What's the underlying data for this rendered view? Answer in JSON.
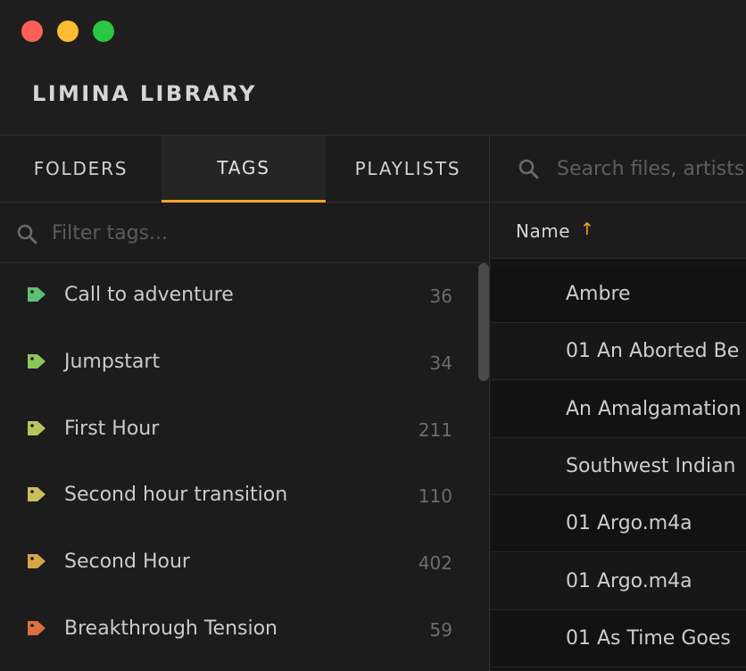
{
  "app": {
    "title": "LIMINA LIBRARY"
  },
  "tabs": [
    {
      "label": "FOLDERS"
    },
    {
      "label": "TAGS"
    },
    {
      "label": "PLAYLISTS"
    }
  ],
  "active_tab": "TAGS",
  "tag_filter": {
    "placeholder": "Filter tags..."
  },
  "tags": [
    {
      "name": "Call to adventure",
      "count": "36",
      "color": "#5fbf74"
    },
    {
      "name": "Jumpstart",
      "count": "34",
      "color": "#8cc65a"
    },
    {
      "name": "First Hour",
      "count": "211",
      "color": "#b9c461"
    },
    {
      "name": "Second hour transition",
      "count": "110",
      "color": "#c9bf5c"
    },
    {
      "name": "Second Hour",
      "count": "402",
      "color": "#d6a54a"
    },
    {
      "name": "Breakthrough Tension",
      "count": "59",
      "color": "#d9703e"
    }
  ],
  "search": {
    "placeholder": "Search files, artists..."
  },
  "file_table": {
    "column_name": "Name",
    "sort_indicator": "↑",
    "rows": [
      {
        "name": "Ambre"
      },
      {
        "name": "01 An Aborted Be"
      },
      {
        "name": "An Amalgamation"
      },
      {
        "name": "Southwest Indian"
      },
      {
        "name": "01 Argo.m4a"
      },
      {
        "name": "01 Argo.m4a"
      },
      {
        "name": "01 As Time Goes"
      }
    ]
  },
  "colors": {
    "accent": "#f5a623",
    "background": "#1b1b1c",
    "traffic_close": "#fe5f57",
    "traffic_minimize": "#febc2e",
    "traffic_maximize": "#28c840"
  }
}
